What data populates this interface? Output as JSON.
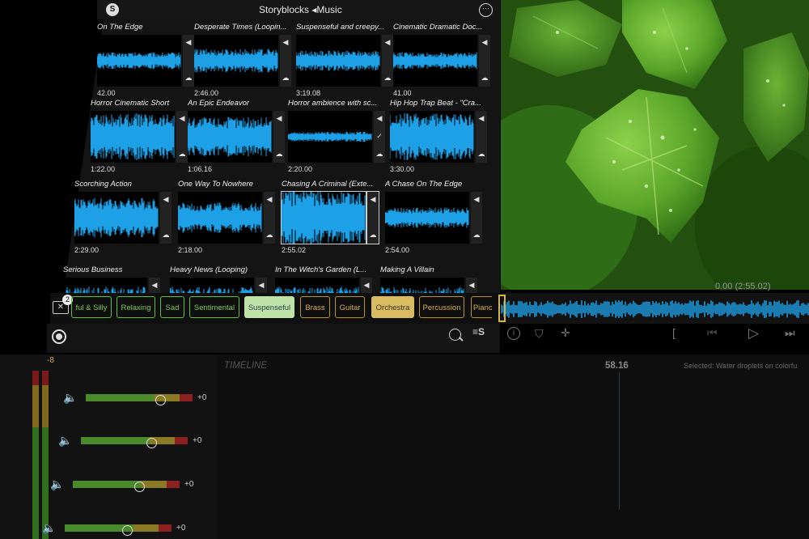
{
  "header": {
    "title": "Storyblocks ◂Music",
    "logo_letter": "S",
    "more_glyph": "···"
  },
  "tracks": [
    {
      "title": "On The Edge",
      "duration": "42.00"
    },
    {
      "title": "Desperate Times (Loopin...",
      "duration": "2:46.00"
    },
    {
      "title": "Suspenseful and creepy...",
      "duration": "3:19.08"
    },
    {
      "title": "Cinematic Dramatic Doc...",
      "duration": "41.00"
    },
    {
      "title": "Horror Cinematic Short",
      "duration": "1:22.00"
    },
    {
      "title": "An Epic Endeavor",
      "duration": "1:06.16"
    },
    {
      "title": "Horror ambience with sc...",
      "duration": "2:20.00"
    },
    {
      "title": "Hip Hop Trap Beat - \"Cra...",
      "duration": "3:30.00"
    },
    {
      "title": "Scorching Action",
      "duration": "2:29.00"
    },
    {
      "title": "One Way To Nowhere",
      "duration": "2:18.00"
    },
    {
      "title": "Chasing A Criminal (Exte...",
      "duration": "2:55.02"
    },
    {
      "title": "A Chase On The Edge",
      "duration": "2:54.00"
    },
    {
      "title": "Serious Business",
      "duration": ""
    },
    {
      "title": "Heavy News (Looping)",
      "duration": ""
    },
    {
      "title": "In The Witch's Garden (L...",
      "duration": ""
    },
    {
      "title": "Making A Villain",
      "duration": ""
    }
  ],
  "filter": {
    "clear_glyph": "✕",
    "count": "2"
  },
  "tags": [
    {
      "label": "ful & Silly",
      "style": "g"
    },
    {
      "label": "Relaxing",
      "style": "g"
    },
    {
      "label": "Sad",
      "style": "g"
    },
    {
      "label": "Sentimental",
      "style": "g"
    },
    {
      "label": "Suspenseful",
      "style": "ga"
    },
    {
      "label": "Brass",
      "style": "o"
    },
    {
      "label": "Guitar",
      "style": "o"
    },
    {
      "label": "Orchestra",
      "style": "oa"
    },
    {
      "label": "Percussion",
      "style": "o"
    },
    {
      "label": "Piano",
      "style": "o"
    }
  ],
  "bottom": {
    "sort_glyph": "≡S"
  },
  "preview": {
    "time": "0.00  (2:55.02)"
  },
  "controls": {
    "info": "i",
    "marker": "⛉",
    "split": "✛",
    "in_mark": "[",
    "prev": "⏮",
    "play": "▷",
    "next": "⏭"
  },
  "timeline": {
    "label": "TIMELINE",
    "time": "58.16",
    "selected": "Selected: Water droplets on colorfu"
  },
  "mixer": {
    "db_top": "-8",
    "channels": [
      {
        "value": "+0",
        "level": 0.7
      },
      {
        "value": "+0",
        "level": 0.66
      },
      {
        "value": "+0",
        "level": 0.62
      },
      {
        "value": "+0",
        "level": 0.58
      }
    ]
  },
  "colors": {
    "waveform": "#1ea0e6",
    "accent_green": "#5fbf3a",
    "accent_orange": "#d9bb62"
  }
}
